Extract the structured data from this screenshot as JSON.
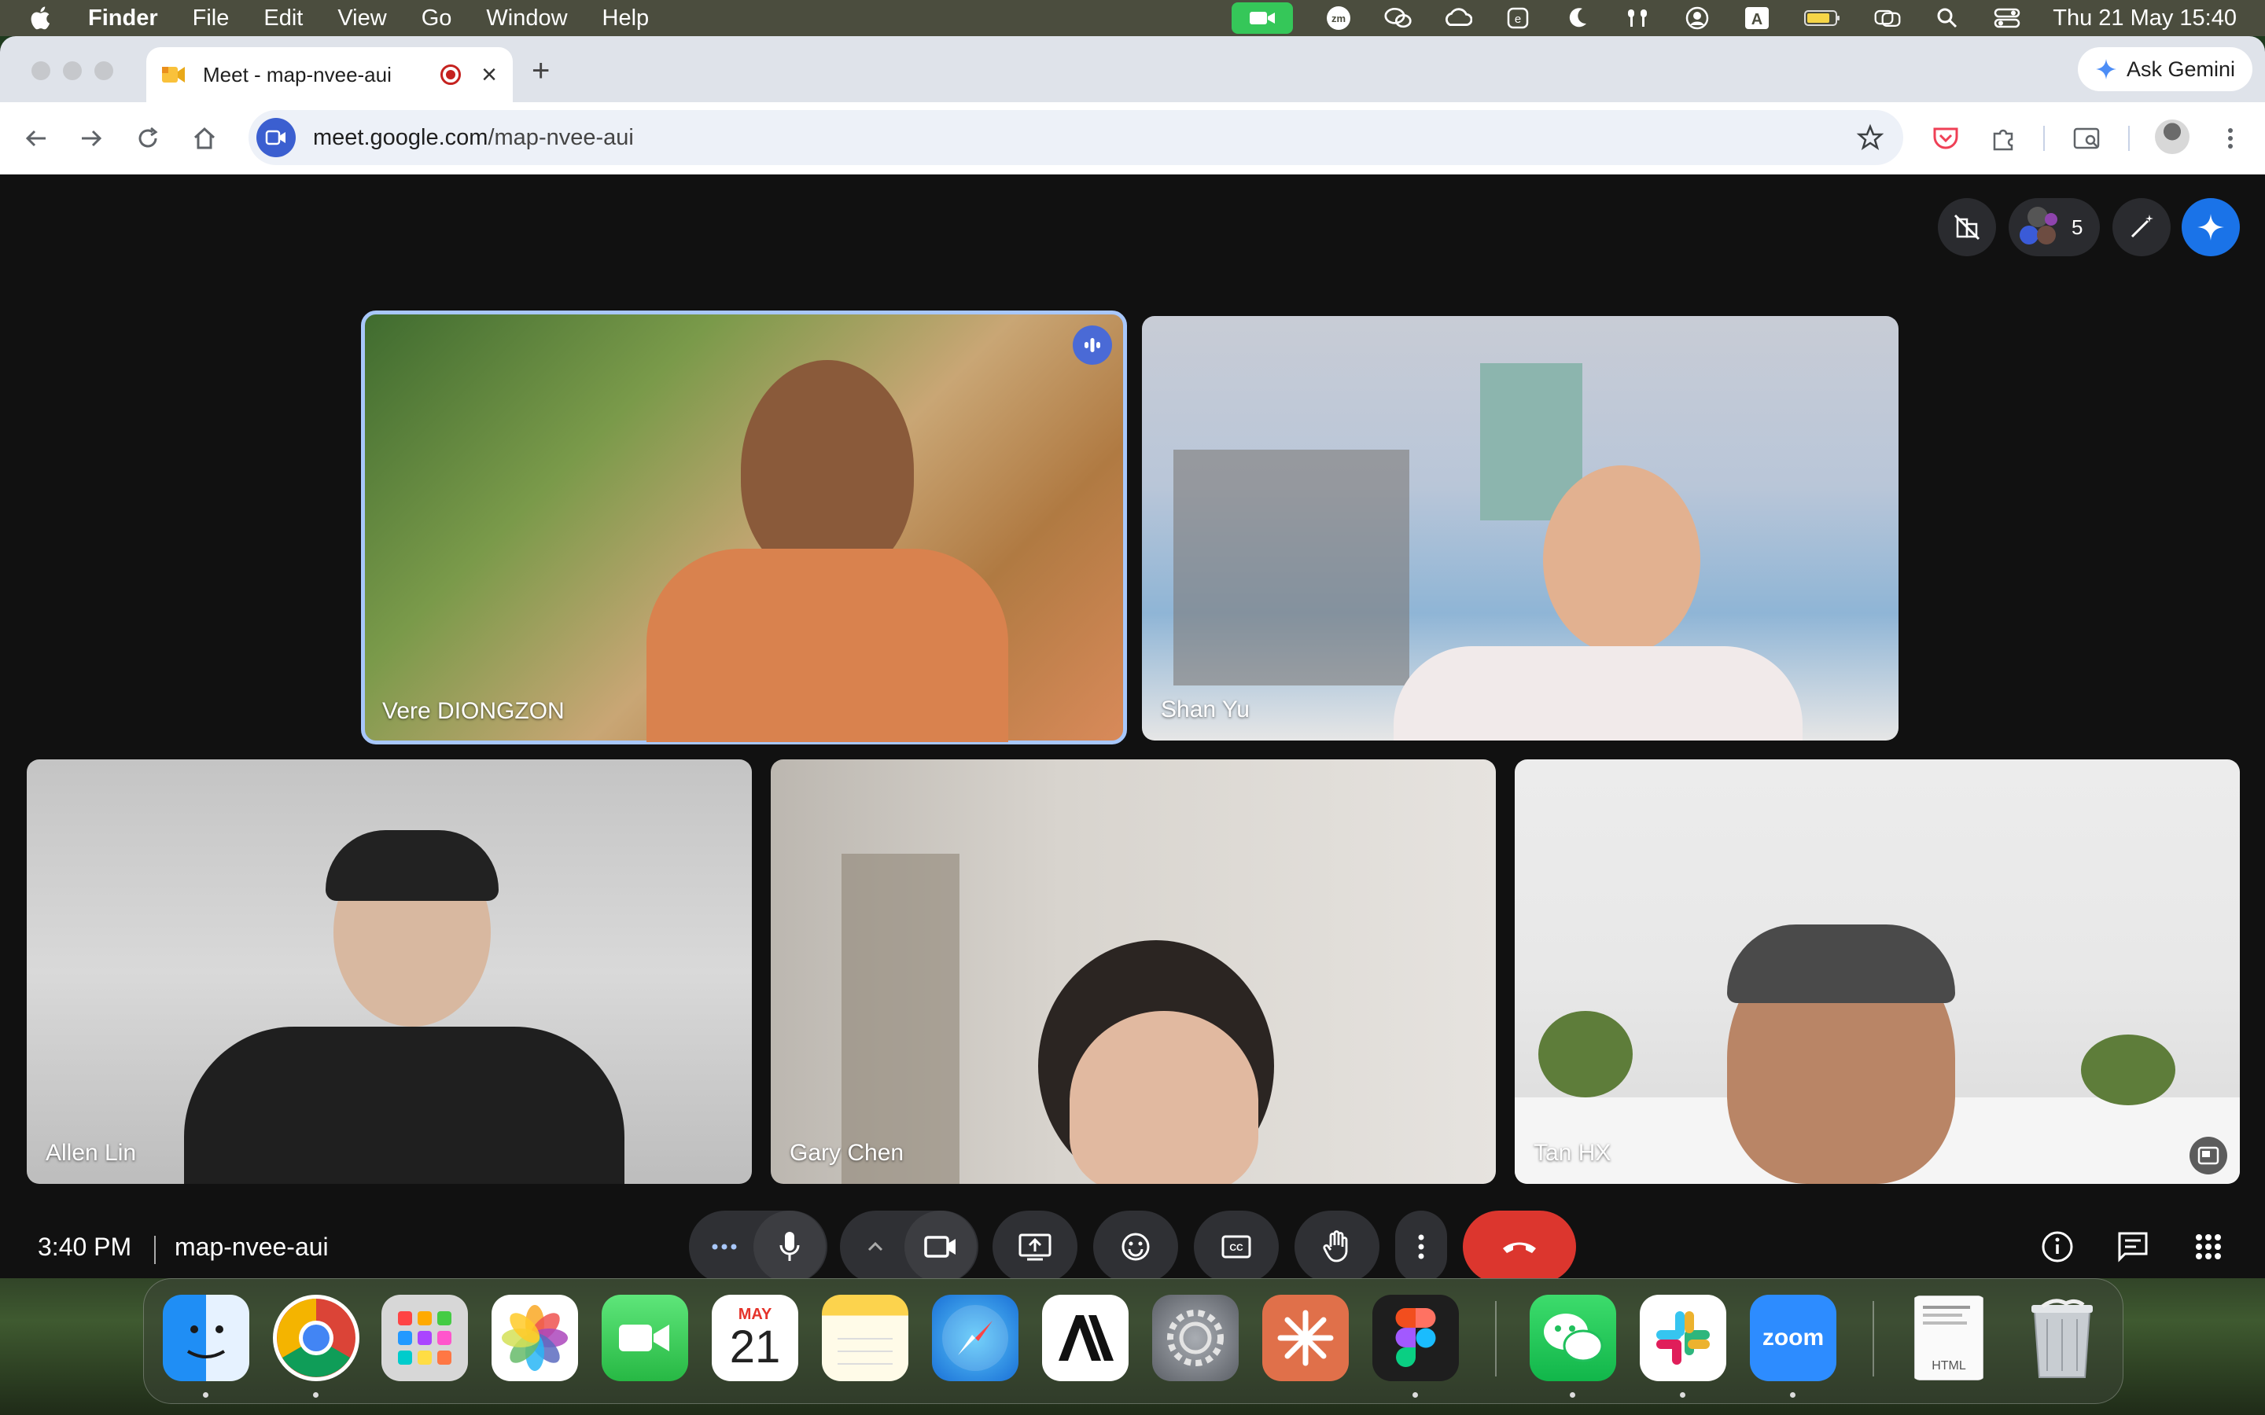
{
  "menubar": {
    "app_name": "Finder",
    "items": [
      "File",
      "Edit",
      "View",
      "Go",
      "Window",
      "Help"
    ],
    "status_icons": [
      "facetime-active-icon",
      "zoom-icon",
      "wechat-icon",
      "creative-cloud-icon",
      "e-icon",
      "moon-icon",
      "airpods-icon",
      "user-icon",
      "input-source-icon",
      "battery-icon",
      "screen-mirror-icon",
      "spotlight-icon",
      "control-center-icon"
    ],
    "input_source_label": "A",
    "clock": "Thu 21 May  15:40"
  },
  "browser": {
    "tab": {
      "title": "Meet - map-nvee-aui"
    },
    "new_tab_label": "+",
    "ask_gemini_label": "Ask Gemini",
    "url_host": "meet.google.com",
    "url_path": "/map-nvee-aui"
  },
  "meet": {
    "participant_count": "5",
    "participants": [
      {
        "name": "Vere DIONGZON",
        "speaking": true
      },
      {
        "name": "Shan Yu",
        "speaking": false
      },
      {
        "name": "Allen Lin",
        "speaking": false
      },
      {
        "name": "Gary Chen",
        "speaking": false
      },
      {
        "name": "Tan HX",
        "speaking": false
      }
    ],
    "time": "3:40 PM",
    "meeting_code": "map-nvee-aui"
  },
  "dock": {
    "apps": [
      "Finder",
      "Chrome",
      "Launchpad",
      "Photos",
      "FaceTime",
      "Calendar",
      "Notes",
      "Safari",
      "Anthropic",
      "System Settings",
      "Claude",
      "Figma",
      "WeChat",
      "Slack",
      "Zoom",
      "HTML document",
      "Trash"
    ],
    "calendar_month": "MAY",
    "calendar_day": "21",
    "zoom_label": "zoom",
    "html_doc_label": "HTML"
  },
  "colors": {
    "meet_bg": "#111111",
    "end_call": "#dc362e",
    "active_outline": "#a8c7fa",
    "gemini_blue": "#1a73e8"
  }
}
